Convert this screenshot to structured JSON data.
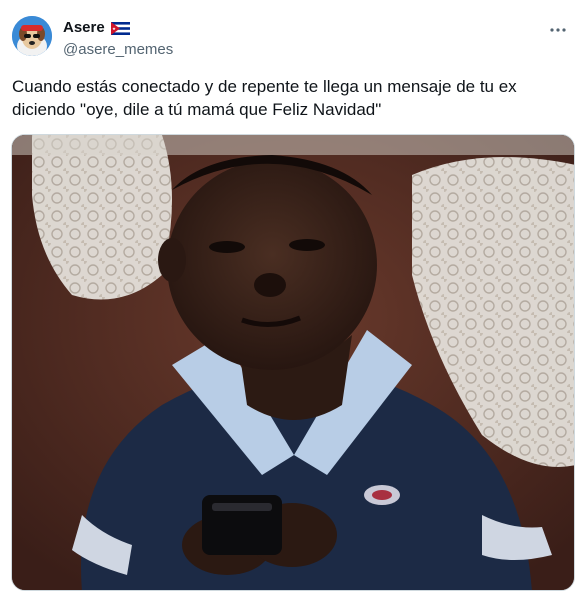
{
  "author": {
    "display_name": "Asere",
    "handle": "@asere_memes",
    "flag_icon": "cuba-flag-icon",
    "avatar_icon": "cartoon-dog-avatar-icon"
  },
  "tweet": {
    "text": "Cuando estás conectado y de repente te llega un mensaje de tu ex diciendo \"oye, dile a tú mamá que Feliz Navidad\""
  },
  "more_icon": "more-options-icon",
  "colors": {
    "text_primary": "#0f1419",
    "text_secondary": "#536471",
    "border": "#cfd9de"
  }
}
